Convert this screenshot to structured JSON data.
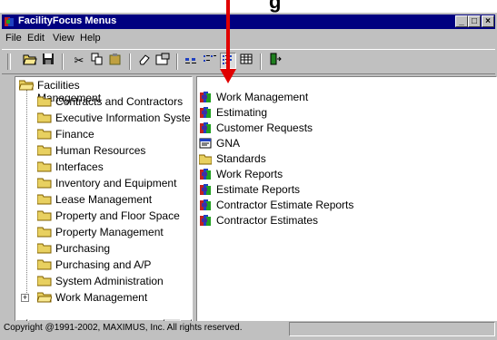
{
  "overlay": {
    "cut_text": "g"
  },
  "window": {
    "title": "FacilityFocus Menus",
    "min_label": "_",
    "max_label": "□",
    "close_label": "×"
  },
  "menu": [
    "File",
    "Edit",
    "View",
    "Help"
  ],
  "toolbar_icons": [
    "open-folder-icon",
    "save-icon",
    "cut-icon",
    "copy-icon",
    "paste-icon",
    "eraser-icon",
    "properties-icon",
    "large-icons-view",
    "small-icons-view",
    "list-view",
    "details-view",
    "exit-icon"
  ],
  "tree": {
    "root": "Facilities Management",
    "items": [
      "Contracts and Contractors",
      "Executive Information Syste",
      "Finance",
      "Human Resources",
      "Interfaces",
      "Inventory and Equipment",
      "Lease Management",
      "Property and Floor Space",
      "Property Management",
      "Purchasing",
      "Purchasing and A/P",
      "System Administration",
      "Work Management"
    ]
  },
  "list": [
    {
      "label": "Work Management",
      "icon": "book-icon"
    },
    {
      "label": "Estimating",
      "icon": "book-icon"
    },
    {
      "label": "Customer Requests",
      "icon": "book-icon"
    },
    {
      "label": "GNA",
      "icon": "form-icon"
    },
    {
      "label": "Standards",
      "icon": "folder-icon"
    },
    {
      "label": "Work Reports",
      "icon": "book-icon"
    },
    {
      "label": "Estimate Reports",
      "icon": "book-icon"
    },
    {
      "label": "Contractor Estimate Reports",
      "icon": "book-icon"
    },
    {
      "label": "Contractor Estimates",
      "icon": "book-icon"
    }
  ],
  "status": {
    "text": "Copyright @1991-2002, MAXIMUS, Inc. All rights reserved."
  },
  "colors": {
    "title_bar": "#000080",
    "chrome": "#c0c0c0",
    "arrow": "#e00000",
    "folder": "#e8d060"
  }
}
